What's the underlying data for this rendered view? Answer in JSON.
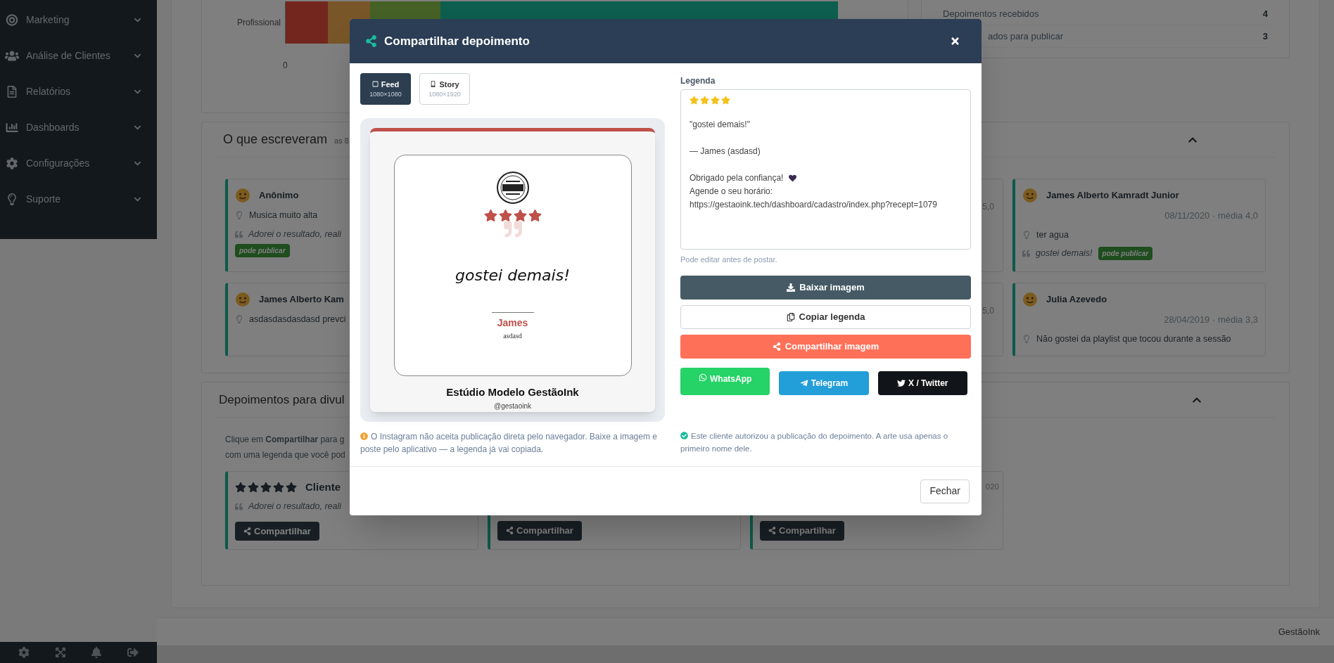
{
  "sidebar": {
    "items": [
      {
        "label": "Marketing"
      },
      {
        "label": "Análise de Clientes"
      },
      {
        "label": "Relatórios"
      },
      {
        "label": "Dashboards"
      },
      {
        "label": "Configurações"
      },
      {
        "label": "Suporte"
      }
    ]
  },
  "chart": {
    "row_label": "Profissional",
    "tick": "0"
  },
  "stats": [
    {
      "label": "Depoimentos recebidos",
      "value": "4"
    },
    {
      "label": "ados para publicar",
      "value": "3"
    }
  ],
  "written": {
    "title": "O que escreveram",
    "subtitle": "as 8",
    "left_cards": [
      {
        "name": "Anônimo",
        "note": "Musica muito alta",
        "quote": "Adorei o resultado, reali",
        "badge": "pode publicar"
      },
      {
        "name": "James Alberto Kam",
        "note": "asdasdasdasdasd prevci"
      }
    ],
    "middle_cards": [
      {
        "meta": "5,0"
      },
      {
        "meta": "5,0"
      }
    ],
    "right_cards": [
      {
        "name": "James Alberto Kamradt Junior",
        "meta": "08/11/2020 · média 4,0",
        "note": "ter agua",
        "quote": "gostei demais!",
        "badge": "pode publicar"
      },
      {
        "name": "Julia Azevedo",
        "meta": "28/04/2019 · média 3,3",
        "note": "Não gostei da playlist que tocou durante a sessão"
      }
    ]
  },
  "publish": {
    "title": "Depoimentos para divul",
    "intro": [
      "Clique em **Compartilhar** para g",
      "com uma legenda que você pod"
    ],
    "cards": [
      {
        "stars": 5,
        "name": "Cliente",
        "quote": "Adorei o resultado, reali",
        "button": "Compartilhar"
      },
      {
        "button": "Compartilhar"
      },
      {
        "meta": "020",
        "button": "Compartilhar"
      }
    ]
  },
  "footer": {
    "brand": "GestãoInk"
  },
  "modal": {
    "title": "Compartilhar depoimento",
    "formats": [
      {
        "label": "Feed",
        "size": "1080×1080",
        "selected": true
      },
      {
        "label": "Story",
        "size": "1080×1920",
        "selected": false
      }
    ],
    "preview": {
      "stars": 4,
      "quote": "gostei demais!",
      "name": "James",
      "subtitle": "asdasd",
      "studio": "Estúdio Modelo GestãoInk",
      "handle": "@gestaoink"
    },
    "instagram_note": "O Instagram não aceita publicação direta pelo navegador. Baixe a imagem e poste pelo aplicativo — a legenda já vai copiada.",
    "caption": {
      "label": "Legenda",
      "stars": 4,
      "lines": [
        {
          "kind": "quote",
          "text": "\"gostei demais!\""
        },
        {
          "kind": "author",
          "text": "— James (asdasd)"
        },
        {
          "kind": "thanks",
          "text": "Obrigado pela confiança!"
        },
        {
          "kind": "text",
          "text": "Agende o seu horário:"
        },
        {
          "kind": "link",
          "text": "https://gestaoink.tech/dashboard/cadastro/index.php?recept=1079"
        }
      ],
      "hint": "Pode editar antes de postar."
    },
    "actions": [
      {
        "kind": "download",
        "label": "Baixar imagem"
      },
      {
        "kind": "copy",
        "label": "Copiar legenda"
      },
      {
        "kind": "share",
        "label": "Compartilhar imagem"
      }
    ],
    "networks": [
      {
        "kind": "whatsapp",
        "label": "WhatsApp"
      },
      {
        "kind": "telegram",
        "label": "Telegram"
      },
      {
        "kind": "twitter",
        "label": "X / Twitter"
      }
    ],
    "consent_note": "Este cliente autorizou a publicação do depoimento. A arte usa apenas o primeiro nome dele.",
    "close_button": "Fechar"
  }
}
